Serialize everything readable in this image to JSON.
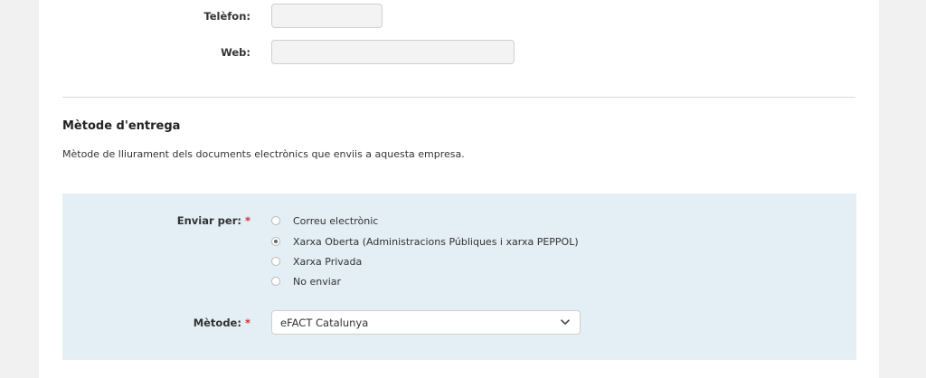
{
  "contact": {
    "phone_label": "Telèfon:",
    "phone_value": "",
    "web_label": "Web:",
    "web_value": ""
  },
  "delivery": {
    "title": "Mètode d'entrega",
    "description": "Mètode de lliurament dels documents electrònics que enviis a aquesta empresa.",
    "send_by_label": "Enviar per:",
    "required_mark": "*",
    "options": [
      {
        "label": "Correu electrònic",
        "checked": false
      },
      {
        "label": "Xarxa Oberta (Administracions Públiques i xarxa PEPPOL)",
        "checked": true
      },
      {
        "label": "Xarxa Privada",
        "checked": false
      },
      {
        "label": "No enviar",
        "checked": false
      }
    ],
    "method_label": "Mètode:",
    "method_value": "eFACT Catalunya",
    "method_icon": "chevron-down-icon"
  },
  "colors": {
    "panel_bg": "#e4eef5",
    "required": "#d32f2f",
    "page_bg": "#f1f1f1"
  }
}
